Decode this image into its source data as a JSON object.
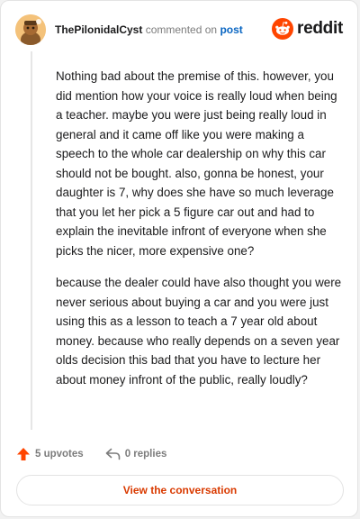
{
  "header": {
    "username": "ThePilonidalCyst",
    "commented_text": "commented on",
    "post_link": "post"
  },
  "logo": {
    "text": "reddit",
    "icon": "reddit-snoo-icon",
    "color": "#ff4500"
  },
  "comment": {
    "paragraphs": [
      "Nothing bad about the premise of this. however, you did mention how your voice is really loud when being a teacher. maybe you were just being really loud in general and it came off like you were making a speech to the whole car dealership on why this car should not be bought. also, gonna be honest, your daughter is 7, why does she have so much leverage that you let her pick a 5 figure car out and had to explain the inevitable infront of everyone when she picks the nicer, more expensive one?",
      "because the dealer could have also thought you were never serious about buying a car and you were just using this as a lesson to teach a 7 year old about money. because who really depends on a seven year olds decision this bad that you have to lecture her about money infront of the public, really loudly?"
    ]
  },
  "actions": {
    "upvotes": "5 upvotes",
    "replies": "0 replies",
    "upvote_icon": "upvote-arrow-icon",
    "reply_icon": "reply-arrow-icon",
    "upvote_color": "#ff4500"
  },
  "cta": {
    "label": "View the conversation",
    "color": "#d93a00"
  }
}
